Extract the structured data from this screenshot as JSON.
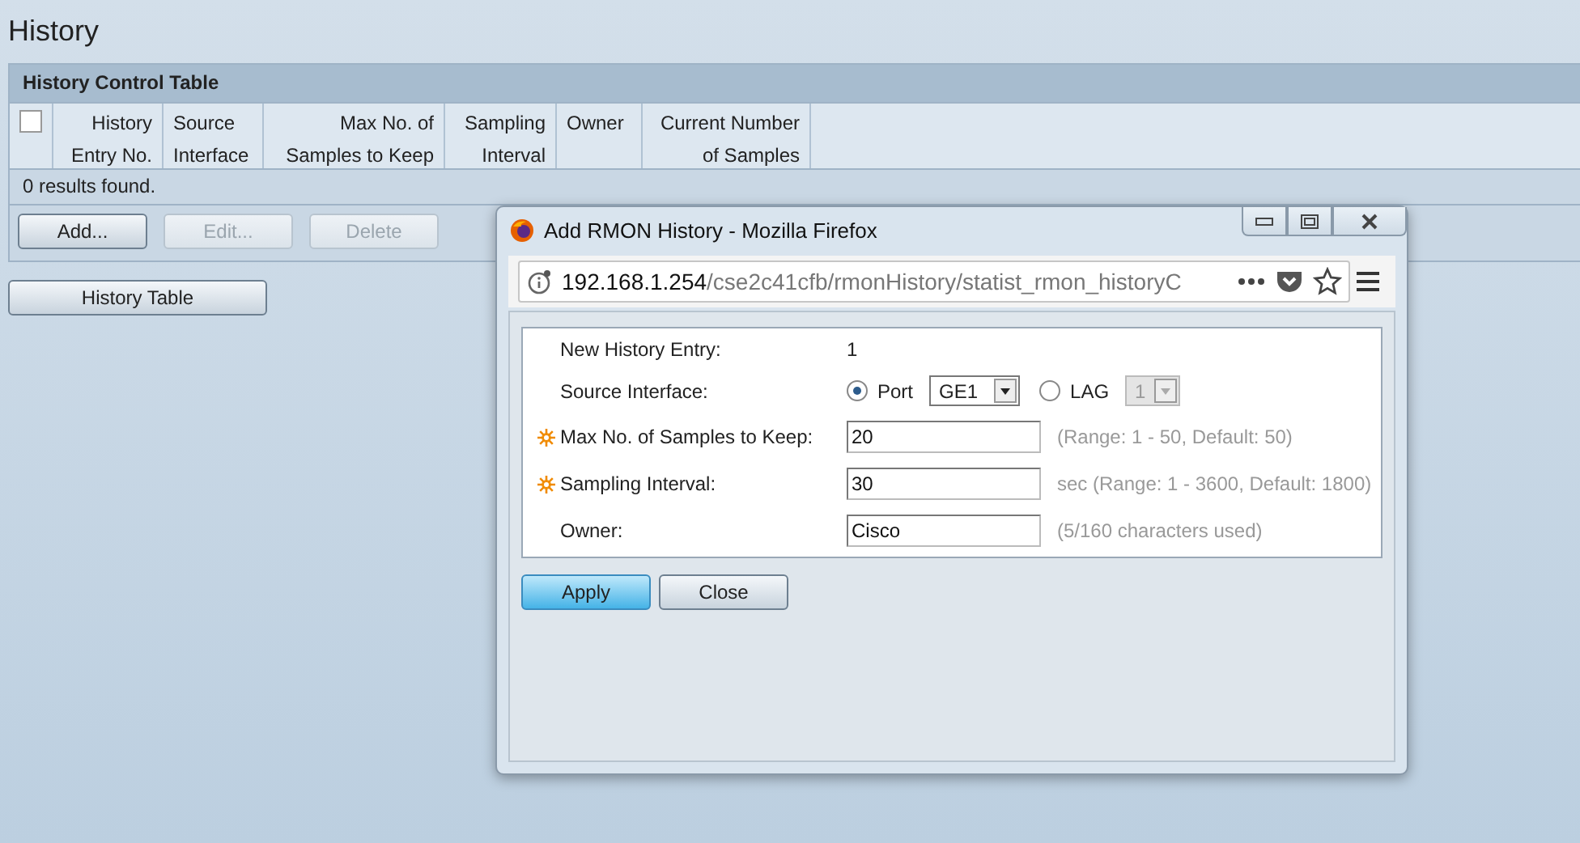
{
  "page_title": "History",
  "history_control_table": {
    "title": "History Control Table",
    "select_all_checked": false,
    "columns": [
      "History Entry No.",
      "Source Interface",
      "Max No. of Samples to Keep",
      "Sampling Interval",
      "Owner",
      "Current Number of Samples"
    ],
    "status": "0 results found.",
    "buttons": [
      {
        "label": "Add...",
        "disabled": false
      },
      {
        "label": "Edit...",
        "disabled": true
      },
      {
        "label": "Delete",
        "disabled": true
      }
    ]
  },
  "history_table_button": "History Table",
  "dialog": {
    "title": "Add RMON History - Mozilla Firefox",
    "url_host": "192.168.1.254",
    "url_path": "/cse2c41cfb/rmonHistory/statist_rmon_historyC",
    "fields": [
      {
        "kind": "value",
        "label": "New History Entry:",
        "value": "1"
      },
      {
        "kind": "source",
        "label": "Source Interface:",
        "options": [
          {
            "label": "Port",
            "selected": true,
            "select_value": "GE1",
            "disabled": false
          },
          {
            "label": "LAG",
            "selected": false,
            "select_value": "1",
            "disabled": true
          }
        ]
      },
      {
        "kind": "input",
        "label": "Max No. of Samples to Keep:",
        "required": true,
        "value": "20",
        "hint": "(Range: 1 - 50, Default: 50)"
      },
      {
        "kind": "input",
        "label": "Sampling Interval:",
        "required": true,
        "value": "30",
        "hint": "sec (Range: 1 - 3600, Default: 1800)"
      },
      {
        "kind": "input",
        "label": "Owner:",
        "required": false,
        "value": "Cisco",
        "hint": "(5/160 characters used)"
      }
    ],
    "buttons": [
      {
        "label": "Apply",
        "primary": true
      },
      {
        "label": "Close",
        "primary": false
      }
    ]
  }
}
